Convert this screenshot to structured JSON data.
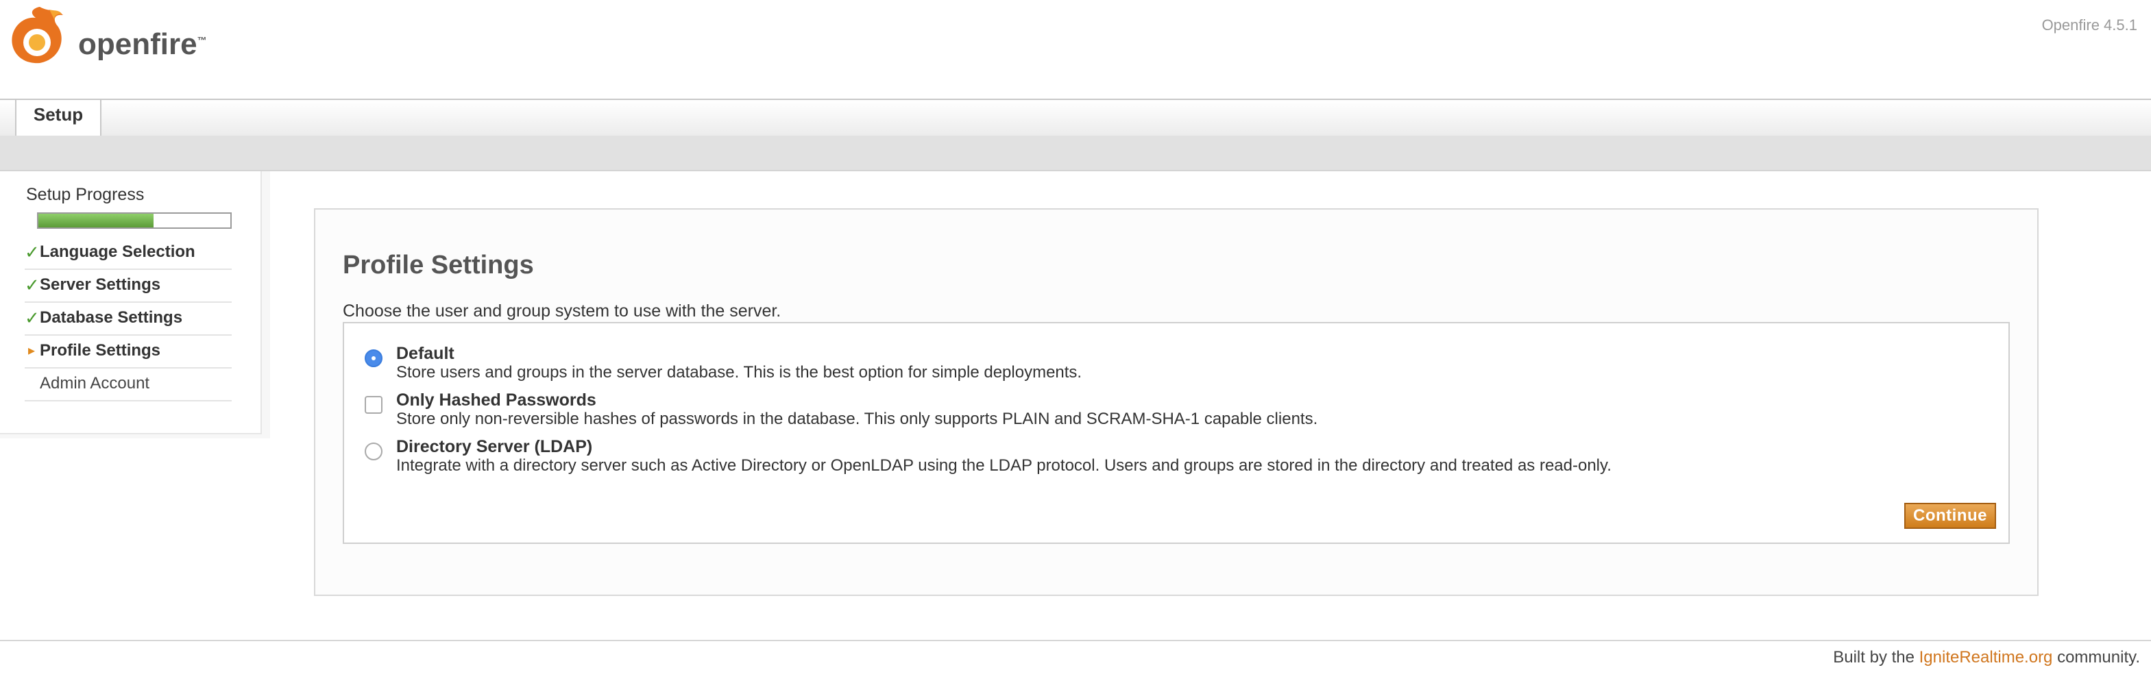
{
  "header": {
    "logo_text": "openfire",
    "logo_tm": "™",
    "version": "Openfire 4.5.1"
  },
  "tabs": [
    {
      "label": "Setup",
      "active": true
    }
  ],
  "sidebar": {
    "progress_label": "Setup Progress",
    "progress_value": 0.6,
    "items": [
      {
        "label": "Language Selection",
        "state": "done",
        "mark": "✓"
      },
      {
        "label": "Server Settings",
        "state": "done",
        "mark": "✓"
      },
      {
        "label": "Database Settings",
        "state": "done",
        "mark": "✓"
      },
      {
        "label": "Profile Settings",
        "state": "active",
        "mark": "▸"
      },
      {
        "label": "Admin Account",
        "state": "pending",
        "mark": ""
      }
    ]
  },
  "main": {
    "title": "Profile Settings",
    "description": "Choose the user and group system to use with the server.",
    "options": [
      {
        "title": "Default",
        "desc": "Store users and groups in the server database. This is the best option for simple deployments.",
        "control": "radio",
        "checked": true
      },
      {
        "title": "Only Hashed Passwords",
        "desc": "Store only non-reversible hashes of passwords in the database. This only supports PLAIN and SCRAM-SHA-1 capable clients.",
        "control": "checkbox",
        "checked": false
      },
      {
        "title": "Directory Server (LDAP)",
        "desc": "Integrate with a directory server such as Active Directory or OpenLDAP using the LDAP protocol. Users and groups are stored in the directory and treated as read-only.",
        "control": "radio",
        "checked": false
      }
    ],
    "continue_label": "Continue"
  },
  "footer": {
    "prefix": "Built by the",
    "link_text": "IgniteRealtime.org",
    "suffix": "community."
  },
  "colors": {
    "accent": "#d0761e",
    "progress_green": "#6aab45",
    "check_green": "#4a9a2e"
  }
}
